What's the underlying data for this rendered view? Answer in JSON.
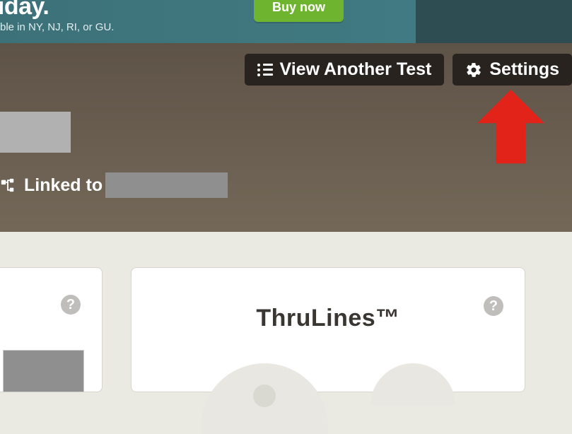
{
  "banner": {
    "title_fragment": "this holiday.",
    "subtitle": "ble in NY, NJ, RI, or GU.",
    "buy_label": "Buy now"
  },
  "actions": {
    "view_test_label": "View Another Test",
    "settings_label": "Settings"
  },
  "linked": {
    "text": "Linked to"
  },
  "cards": {
    "thrulines_title": "ThruLines™"
  }
}
